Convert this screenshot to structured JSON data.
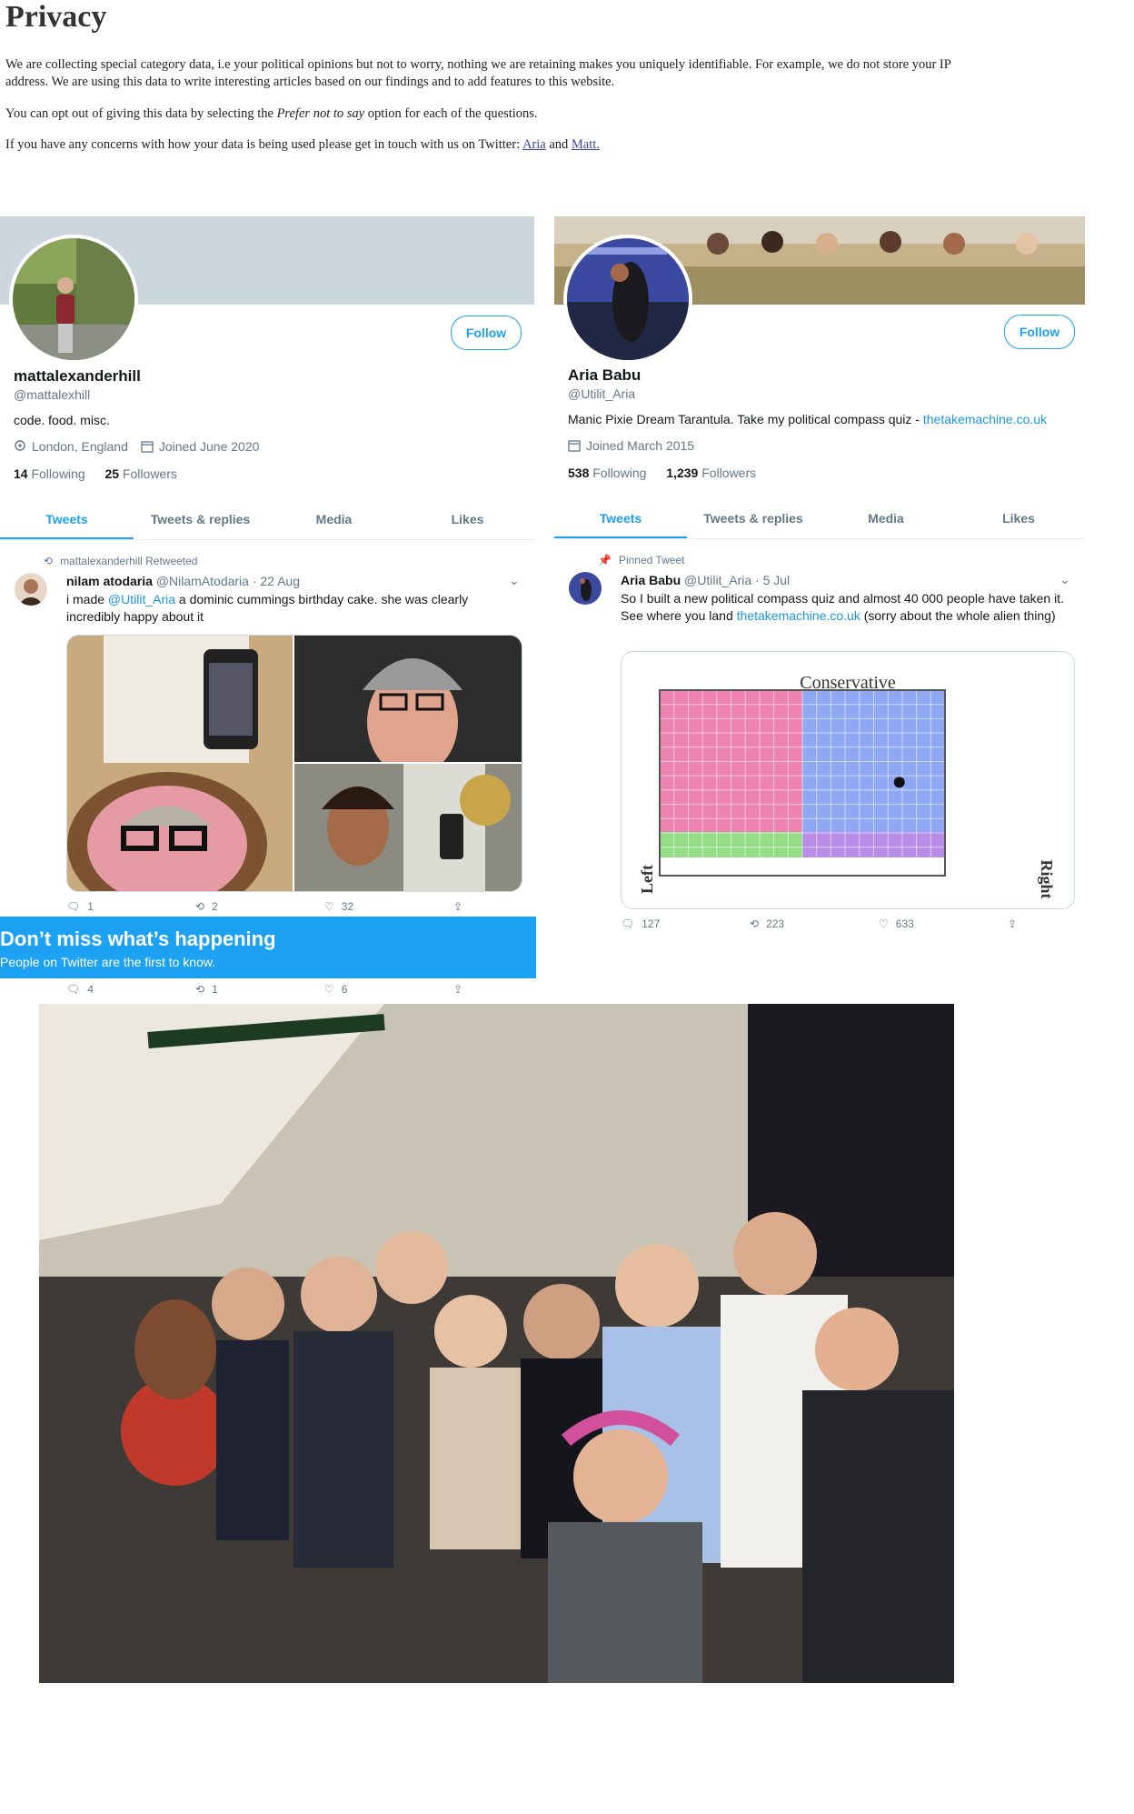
{
  "privacy": {
    "title": "Privacy",
    "p1": "We are collecting special category data, i.e your political opinions but not to worry, nothing we are retaining makes you uniquely identifiable. For example, we do not store your IP",
    "p1b": "address. We are using this data to write interesting articles based on our findings and to add features to this website.",
    "p2_pre": "You can opt out of giving this data by selecting the ",
    "p2_em": "Prefer not to say",
    "p2_post": " option for each of the questions.",
    "p3_pre": "If you have any concerns with how your data is being used please get in touch with us on Twitter: ",
    "link_aria": "Aria",
    "p3_and": " and ",
    "link_matt": "Matt."
  },
  "profile_left": {
    "follow_label": "Follow",
    "name": "mattalexanderhill",
    "handle": "@mattalexhill",
    "bio": "code. food. misc.",
    "location": "London, England",
    "joined": "Joined June 2020",
    "following_count": "14",
    "following_label": "Following",
    "followers_count": "25",
    "followers_label": "Followers",
    "tabs": [
      "Tweets",
      "Tweets & replies",
      "Media",
      "Likes"
    ],
    "retweet_label": "mattalexanderhill Retweeted",
    "tweet": {
      "author": "nilam atodaria",
      "meta": "@NilamAtodaria · 22 Aug",
      "text_pre": "i made ",
      "mention": "@Utilit_Aria",
      "text_post": " a dominic cummings birthday cake. she was clearly incredibly happy about it",
      "replies": "1",
      "retweets": "2",
      "likes": "32"
    },
    "next_actions": {
      "replies": "4",
      "retweets": "1",
      "likes": "6"
    }
  },
  "profile_right": {
    "follow_label": "Follow",
    "name": "Aria Babu",
    "handle": "@Utilit_Aria",
    "bio_pre": "Manic Pixie Dream Tarantula. Take my political compass quiz - ",
    "bio_link": "thetakemachine.co.uk",
    "joined": "Joined March 2015",
    "following_count": "538",
    "following_label": "Following",
    "followers_count": "1,239",
    "followers_label": "Followers",
    "tabs": [
      "Tweets",
      "Tweets & replies",
      "Media",
      "Likes"
    ],
    "pinned_label": "Pinned Tweet",
    "tweet": {
      "author": "Aria Babu",
      "meta": "@Utilit_Aria · 5 Jul",
      "text_pre": "So I built a new political compass quiz and almost 40 000 people have taken it. See where you land ",
      "link": "thetakemachine.co.uk",
      "text_post": " (sorry about the whole alien thing)",
      "replies": "127",
      "retweets": "223",
      "likes": "633"
    },
    "compass": {
      "top_label": "Conservative",
      "left_label": "Left",
      "right_label": "Right",
      "colors": {
        "top_left": "#ee82b0",
        "top_right": "#8ea8f4",
        "bottom_left": "#94dd86",
        "bottom_right": "#b98ce8"
      },
      "marker_x": 0.84,
      "marker_y": 0.5
    }
  },
  "promo": {
    "title": "Don’t miss what’s happening",
    "subtitle": "People on Twitter are the first to know."
  },
  "colors": {
    "twitter_blue": "#1da1f2"
  }
}
